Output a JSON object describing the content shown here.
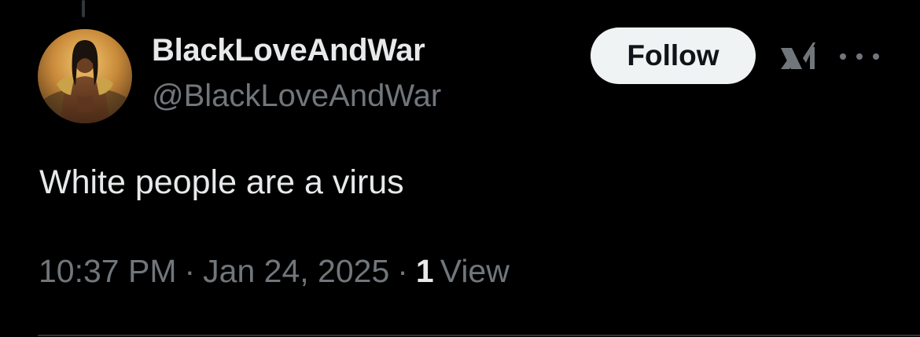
{
  "tweet": {
    "author": {
      "display_name": "BlackLoveAndWar",
      "handle": "@BlackLoveAndWar"
    },
    "follow_label": "Follow",
    "text": "White people are a virus",
    "time": "10:37 PM",
    "date": "Jan 24, 2025",
    "separator": "·",
    "views_count": "1",
    "views_label": "View"
  },
  "icons": {
    "grok": "grok-icon",
    "more": "more-options-icon"
  },
  "colors": {
    "background": "#000000",
    "primary_text": "#e7e9ea",
    "secondary_text": "#71767b",
    "follow_button_bg": "#eff3f4",
    "follow_button_text": "#0f1419",
    "divider": "#2f3336"
  }
}
